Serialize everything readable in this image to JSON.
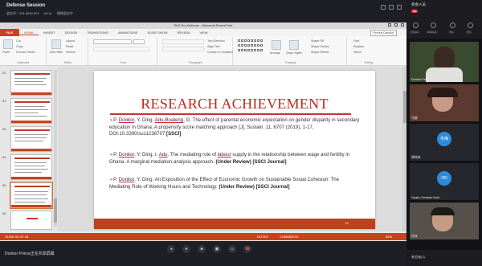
{
  "meeting": {
    "title": "Defense Session",
    "sub_items": [
      "会议号：931 8090 873",
      "04:14",
      "视频会议中"
    ],
    "presenter_label": "Donkor Prince正在共享屏幕"
  },
  "ppt": {
    "window_title": "PhD Pre-Defense - Microsoft PowerPoint",
    "file_tab": "FILE",
    "tabs": [
      "HOME",
      "INSERT",
      "DESIGN",
      "TRANSITIONS",
      "ANIMATIONS",
      "SLIDE SHOW",
      "REVIEW",
      "VIEW"
    ],
    "user": "Prince Donkor",
    "ribbon": {
      "clipboard": {
        "label": "Clipboard",
        "paste": "Paste",
        "cut": "Cut",
        "copy": "Copy",
        "format_painter": "Format Painter"
      },
      "slides": {
        "label": "Slides",
        "new_slide": "New Slide",
        "layout": "Layout",
        "reset": "Reset",
        "section": "Section"
      },
      "font": {
        "label": "Font"
      },
      "paragraph": {
        "label": "Paragraph",
        "text_direction": "Text Direction",
        "align_text": "Align Text",
        "convert": "Convert to SmartArt"
      },
      "drawing": {
        "label": "Drawing",
        "arrange": "Arrange",
        "quick_styles": "Quick Styles",
        "shape_fill": "Shape Fill",
        "shape_outline": "Shape Outline",
        "shape_effects": "Shape Effects"
      },
      "editing": {
        "label": "Editing",
        "find": "Find",
        "replace": "Replace",
        "select": "Select"
      }
    },
    "thumbnails": [
      {
        "num": "51",
        "selected": false
      },
      {
        "num": "52",
        "selected": false
      },
      {
        "num": "53",
        "selected": false
      },
      {
        "num": "54",
        "selected": false
      },
      {
        "num": "55",
        "selected": true
      },
      {
        "num": "56",
        "selected": false
      }
    ],
    "slide": {
      "title": "RESEARCH ACHIEVEMENT",
      "page": "55",
      "items": [
        {
          "authors_a": "P. ",
          "author_u1": "Donkor",
          "authors_b": ", Y. Ding, ",
          "author_u2": "Adu-Boateng",
          "text": ", G. The effect of parental economic expectation on gender disparity in secondary education in Ghana. A propensity score matching approach [J], Sustain. 11, 6707 (2019), 1-17, DOI:10.3390/su11236707 ",
          "tag": "[SSCI]"
        },
        {
          "authors_a": "P. ",
          "author_u1": "Donkor",
          "authors_b": ", Y. Ding, I. ",
          "author_u2": "Adu",
          "text_pre": ". The mediating role of ",
          "word_u": "labour",
          "text": " supply in the relationship between wage and fertility in Ghana. A marginal mediation analysis approach. ",
          "tag": "(Under Review) [SSCI Journal]"
        },
        {
          "authors_a": "P. ",
          "author_u1": "Donkor",
          "text": ", Y. Ding. An Exposition of the Effect of Economic Growth on Sustainable Social Cohesion: The Mediating Role of Working Hours and Technology. ",
          "tag": "(Under Review) [SSCI Journal]"
        }
      ]
    },
    "status": {
      "slide_of": "SLIDE 55 OF 56",
      "notes": "NOTES",
      "comments": "COMMENTS",
      "zoom": "59%"
    }
  },
  "participants": {
    "count_label": "参会人员",
    "badge": "45",
    "tools": [
      "全部静音",
      "解除静音",
      "邀请",
      "更多"
    ],
    "tiles": [
      {
        "name": "Donkor Prince",
        "type": "video"
      },
      {
        "name": "马骏",
        "type": "video"
      },
      {
        "name": "胡伟伟",
        "type": "avatar",
        "initials": "冬梅",
        "color": "#2e8bd9"
      },
      {
        "name": "Opata Christian Nsrh",
        "type": "avatar",
        "initials": "ON",
        "color": "#2e8bd9"
      },
      {
        "name": "孙冰",
        "type": "video"
      }
    ],
    "footer": "参会者(3)"
  }
}
